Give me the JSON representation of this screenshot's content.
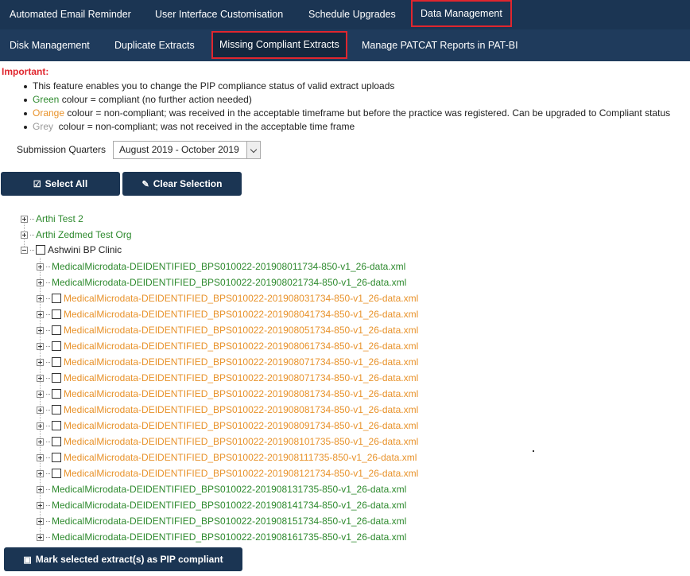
{
  "top_tabs": [
    "Automated Email Reminder",
    "User Interface Customisation",
    "Schedule Upgrades",
    "Data Management"
  ],
  "sub_tabs": [
    "Disk Management",
    "Duplicate Extracts",
    "Missing Compliant Extracts",
    "Manage PATCAT Reports in PAT-BI"
  ],
  "important": {
    "heading": "Important:",
    "line1": "This feature enables you to change the PIP compliance status of valid extract uploads",
    "green_word": "Green",
    "green_rest": " colour = compliant (no further action needed)",
    "orange_word": "Orange",
    "orange_rest": " colour = non-compliant; was received in the acceptable timeframe but before the practice was registered. Can be upgraded to Compliant status",
    "grey_word": "Grey",
    "grey_rest": "  colour = non-compliant; was not received in the acceptable time frame"
  },
  "submission": {
    "label": "Submission Quarters",
    "value": "August 2019 - October 2019"
  },
  "buttons": {
    "select_all": "Select All",
    "clear_selection": "Clear Selection",
    "mark_compliant": "Mark selected extract(s) as PIP compliant"
  },
  "icons": {
    "select_all": "check-square-icon",
    "clear": "eraser-icon",
    "save": "floppy-disk-icon"
  },
  "colors": {
    "nav": "#1b3553",
    "active_border": "#e0262e",
    "green": "#2e8a2e",
    "orange": "#e8922a",
    "grey": "#999999"
  },
  "tree": {
    "orgs": [
      {
        "name": "Arthi Test 2",
        "status": "green"
      },
      {
        "name": "Arthi Zedmed Test Org",
        "status": "green"
      },
      {
        "name": "Ashwini BP Clinic",
        "status": "default"
      }
    ],
    "files": [
      {
        "name": "MedicalMicrodata-DEIDENTIFIED_BPS010022-201908011734-850-v1_26-data.xml",
        "status": "green"
      },
      {
        "name": "MedicalMicrodata-DEIDENTIFIED_BPS010022-201908021734-850-v1_26-data.xml",
        "status": "green"
      },
      {
        "name": "MedicalMicrodata-DEIDENTIFIED_BPS010022-201908031734-850-v1_26-data.xml",
        "status": "orange"
      },
      {
        "name": "MedicalMicrodata-DEIDENTIFIED_BPS010022-201908041734-850-v1_26-data.xml",
        "status": "orange"
      },
      {
        "name": "MedicalMicrodata-DEIDENTIFIED_BPS010022-201908051734-850-v1_26-data.xml",
        "status": "orange"
      },
      {
        "name": "MedicalMicrodata-DEIDENTIFIED_BPS010022-201908061734-850-v1_26-data.xml",
        "status": "orange"
      },
      {
        "name": "MedicalMicrodata-DEIDENTIFIED_BPS010022-201908071734-850-v1_26-data.xml",
        "status": "orange"
      },
      {
        "name": "MedicalMicrodata-DEIDENTIFIED_BPS010022-201908071734-850-v1_26-data.xml",
        "status": "orange"
      },
      {
        "name": "MedicalMicrodata-DEIDENTIFIED_BPS010022-201908081734-850-v1_26-data.xml",
        "status": "orange"
      },
      {
        "name": "MedicalMicrodata-DEIDENTIFIED_BPS010022-201908081734-850-v1_26-data.xml",
        "status": "orange"
      },
      {
        "name": "MedicalMicrodata-DEIDENTIFIED_BPS010022-201908091734-850-v1_26-data.xml",
        "status": "orange"
      },
      {
        "name": "MedicalMicrodata-DEIDENTIFIED_BPS010022-201908101735-850-v1_26-data.xml",
        "status": "orange"
      },
      {
        "name": "MedicalMicrodata-DEIDENTIFIED_BPS010022-201908111735-850-v1_26-data.xml",
        "status": "orange"
      },
      {
        "name": "MedicalMicrodata-DEIDENTIFIED_BPS010022-201908121734-850-v1_26-data.xml",
        "status": "orange"
      },
      {
        "name": "MedicalMicrodata-DEIDENTIFIED_BPS010022-201908131735-850-v1_26-data.xml",
        "status": "green"
      },
      {
        "name": "MedicalMicrodata-DEIDENTIFIED_BPS010022-201908141734-850-v1_26-data.xml",
        "status": "green"
      },
      {
        "name": "MedicalMicrodata-DEIDENTIFIED_BPS010022-201908151734-850-v1_26-data.xml",
        "status": "green"
      },
      {
        "name": "MedicalMicrodata-DEIDENTIFIED_BPS010022-201908161735-850-v1_26-data.xml",
        "status": "green"
      }
    ]
  }
}
